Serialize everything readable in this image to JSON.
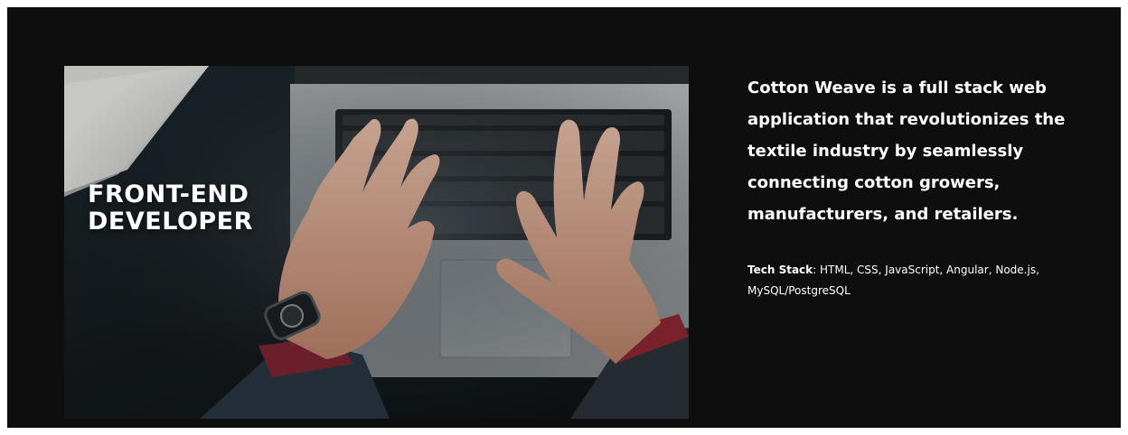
{
  "project": {
    "image": {
      "heading_line1": "FRONT-END",
      "heading_line2": "DEVELOPER",
      "depicts": "hands typing on laptop keyboard"
    },
    "description": "Cotton Weave is a full stack web application that revolutionizes the textile industry by seamlessly connecting cotton growers, manufacturers, and retailers.",
    "tech_stack": {
      "label": "Tech Stack",
      "separator": ":",
      "value": "HTML, CSS, JavaScript, Angular, Node.js, MySQL/PostgreSQL"
    }
  },
  "colors": {
    "section_bg": "#0f0e0e",
    "text": "#ffffff"
  }
}
